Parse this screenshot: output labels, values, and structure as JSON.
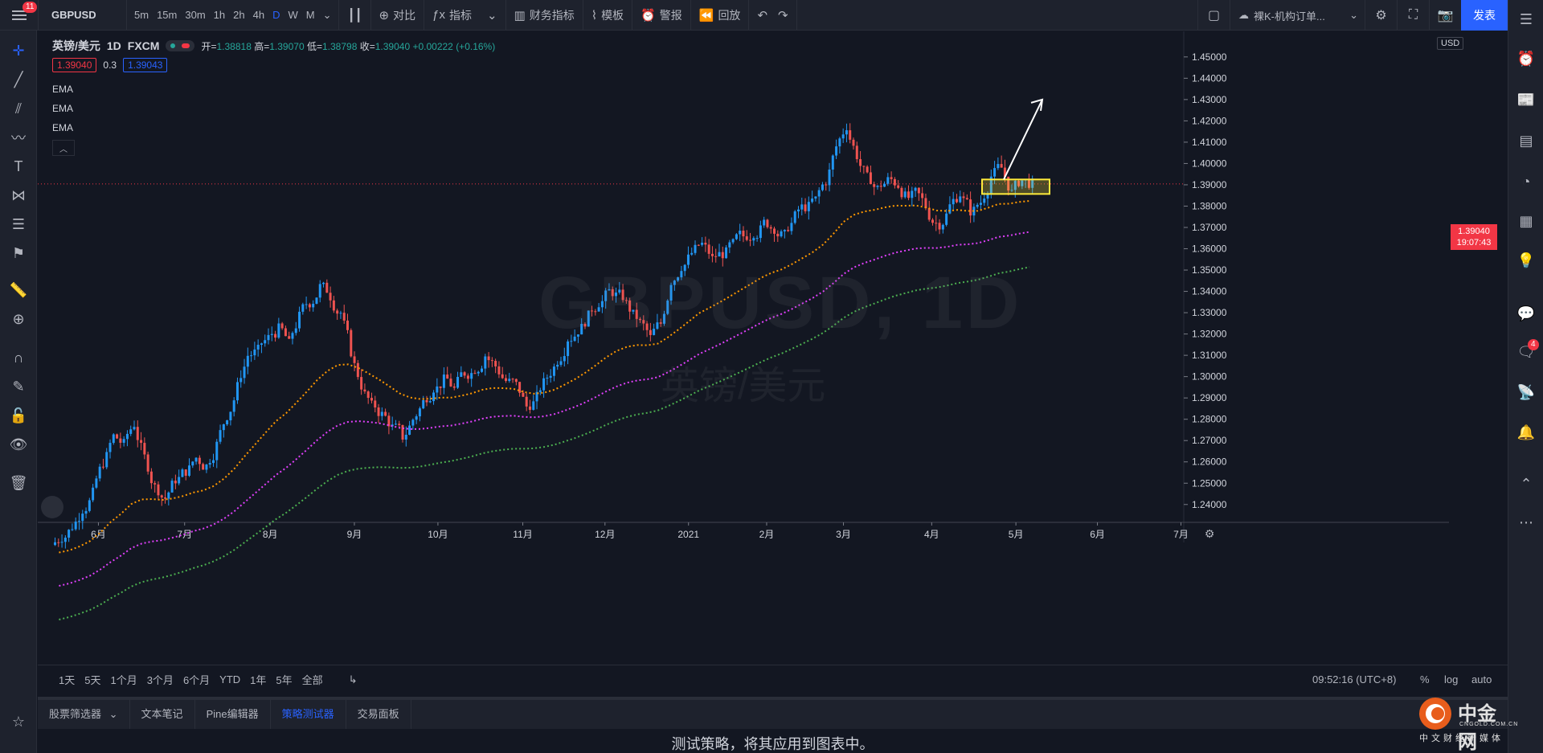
{
  "topbar": {
    "menu_badge": "11",
    "symbol": "GBPUSD",
    "timeframes": [
      "5m",
      "15m",
      "30m",
      "1h",
      "2h",
      "4h",
      "D",
      "W",
      "M"
    ],
    "active_timeframe": "D",
    "compare": "对比",
    "indicators": "指标",
    "financials": "财务指标",
    "templates": "模板",
    "alerts": "警报",
    "replay": "回放",
    "layout_name": "裸K-机构订单...",
    "publish": "发表"
  },
  "legend": {
    "name": "英镑/美元",
    "interval": "1D",
    "exchange": "FXCM",
    "open_label": "开=",
    "open": "1.38818",
    "high_label": "高=",
    "high": "1.39070",
    "low_label": "低=",
    "low": "1.38798",
    "close_label": "收=",
    "close": "1.39040",
    "change": "+0.00222 (+0.16%)",
    "bid": "1.39040",
    "spread": "0.3",
    "ask": "1.39043",
    "indicators": [
      "EMA",
      "EMA",
      "EMA"
    ]
  },
  "watermark": {
    "symbol": "GBPUSD, 1D",
    "name": "英镑/美元"
  },
  "chart_data": {
    "type": "candlestick",
    "currency": "USD",
    "ylim": [
      1.232,
      1.462
    ],
    "y_ticks": [
      "1.24000",
      "1.25000",
      "1.26000",
      "1.27000",
      "1.28000",
      "1.29000",
      "1.30000",
      "1.31000",
      "1.32000",
      "1.33000",
      "1.34000",
      "1.35000",
      "1.36000",
      "1.37000",
      "1.38000",
      "1.39000",
      "1.40000",
      "1.41000",
      "1.42000",
      "1.43000",
      "1.44000",
      "1.45000"
    ],
    "x_ticks": [
      "6月",
      "7月",
      "8月",
      "9月",
      "10月",
      "11月",
      "12月",
      "2021",
      "2月",
      "3月",
      "4月",
      "5月",
      "6月",
      "7月"
    ],
    "last_price": "1.39040",
    "countdown": "19:07:43",
    "close_series": [
      1.225,
      1.23,
      1.238,
      1.245,
      1.26,
      1.272,
      1.268,
      1.278,
      1.262,
      1.248,
      1.243,
      1.252,
      1.256,
      1.262,
      1.258,
      1.268,
      1.282,
      1.295,
      1.31,
      1.312,
      1.318,
      1.322,
      1.315,
      1.328,
      1.335,
      1.342,
      1.338,
      1.33,
      1.312,
      1.296,
      1.286,
      1.282,
      1.276,
      1.272,
      1.28,
      1.288,
      1.295,
      1.298,
      1.294,
      1.302,
      1.304,
      1.31,
      1.305,
      1.298,
      1.296,
      1.286,
      1.29,
      1.3,
      1.308,
      1.318,
      1.322,
      1.328,
      1.335,
      1.34,
      1.338,
      1.332,
      1.325,
      1.318,
      1.325,
      1.345,
      1.352,
      1.358,
      1.362,
      1.355,
      1.358,
      1.362,
      1.366,
      1.368,
      1.372,
      1.37,
      1.366,
      1.375,
      1.38,
      1.383,
      1.392,
      1.408,
      1.418,
      1.404,
      1.393,
      1.388,
      1.392,
      1.39,
      1.384,
      1.385,
      1.376,
      1.372,
      1.38,
      1.386,
      1.378,
      1.382,
      1.394,
      1.398,
      1.386,
      1.392,
      1.39
    ],
    "ema_fast": {
      "color": "#ff9800",
      "start": 1.236,
      "end": 1.382
    },
    "ema_mid": {
      "color": "#e040fb",
      "start": 1.249,
      "end": 1.375
    },
    "ema_slow": {
      "color": "#4caf50",
      "start": 1.259,
      "end": 1.367
    },
    "annotations": [
      "yellow rectangle at last price",
      "white arrow pointing up"
    ]
  },
  "rangebar": {
    "ranges": [
      "1天",
      "5天",
      "1个月",
      "3个月",
      "6个月",
      "YTD",
      "1年",
      "5年",
      "全部"
    ],
    "time": "09:52:16 (UTC+8)",
    "percent": "%",
    "log": "log",
    "auto": "auto"
  },
  "tabs": [
    "股票筛选器",
    "文本笔记",
    "Pine编辑器",
    "策略测试器",
    "交易面板"
  ],
  "active_tab": "策略测试器",
  "bottom_message": "测试策略，将其应用到图表中。",
  "rightbar_badge": "4",
  "logo": {
    "cn": "中金网",
    "en": "CNGOLD.COM.CN",
    "sub": "中文财经新媒体"
  }
}
